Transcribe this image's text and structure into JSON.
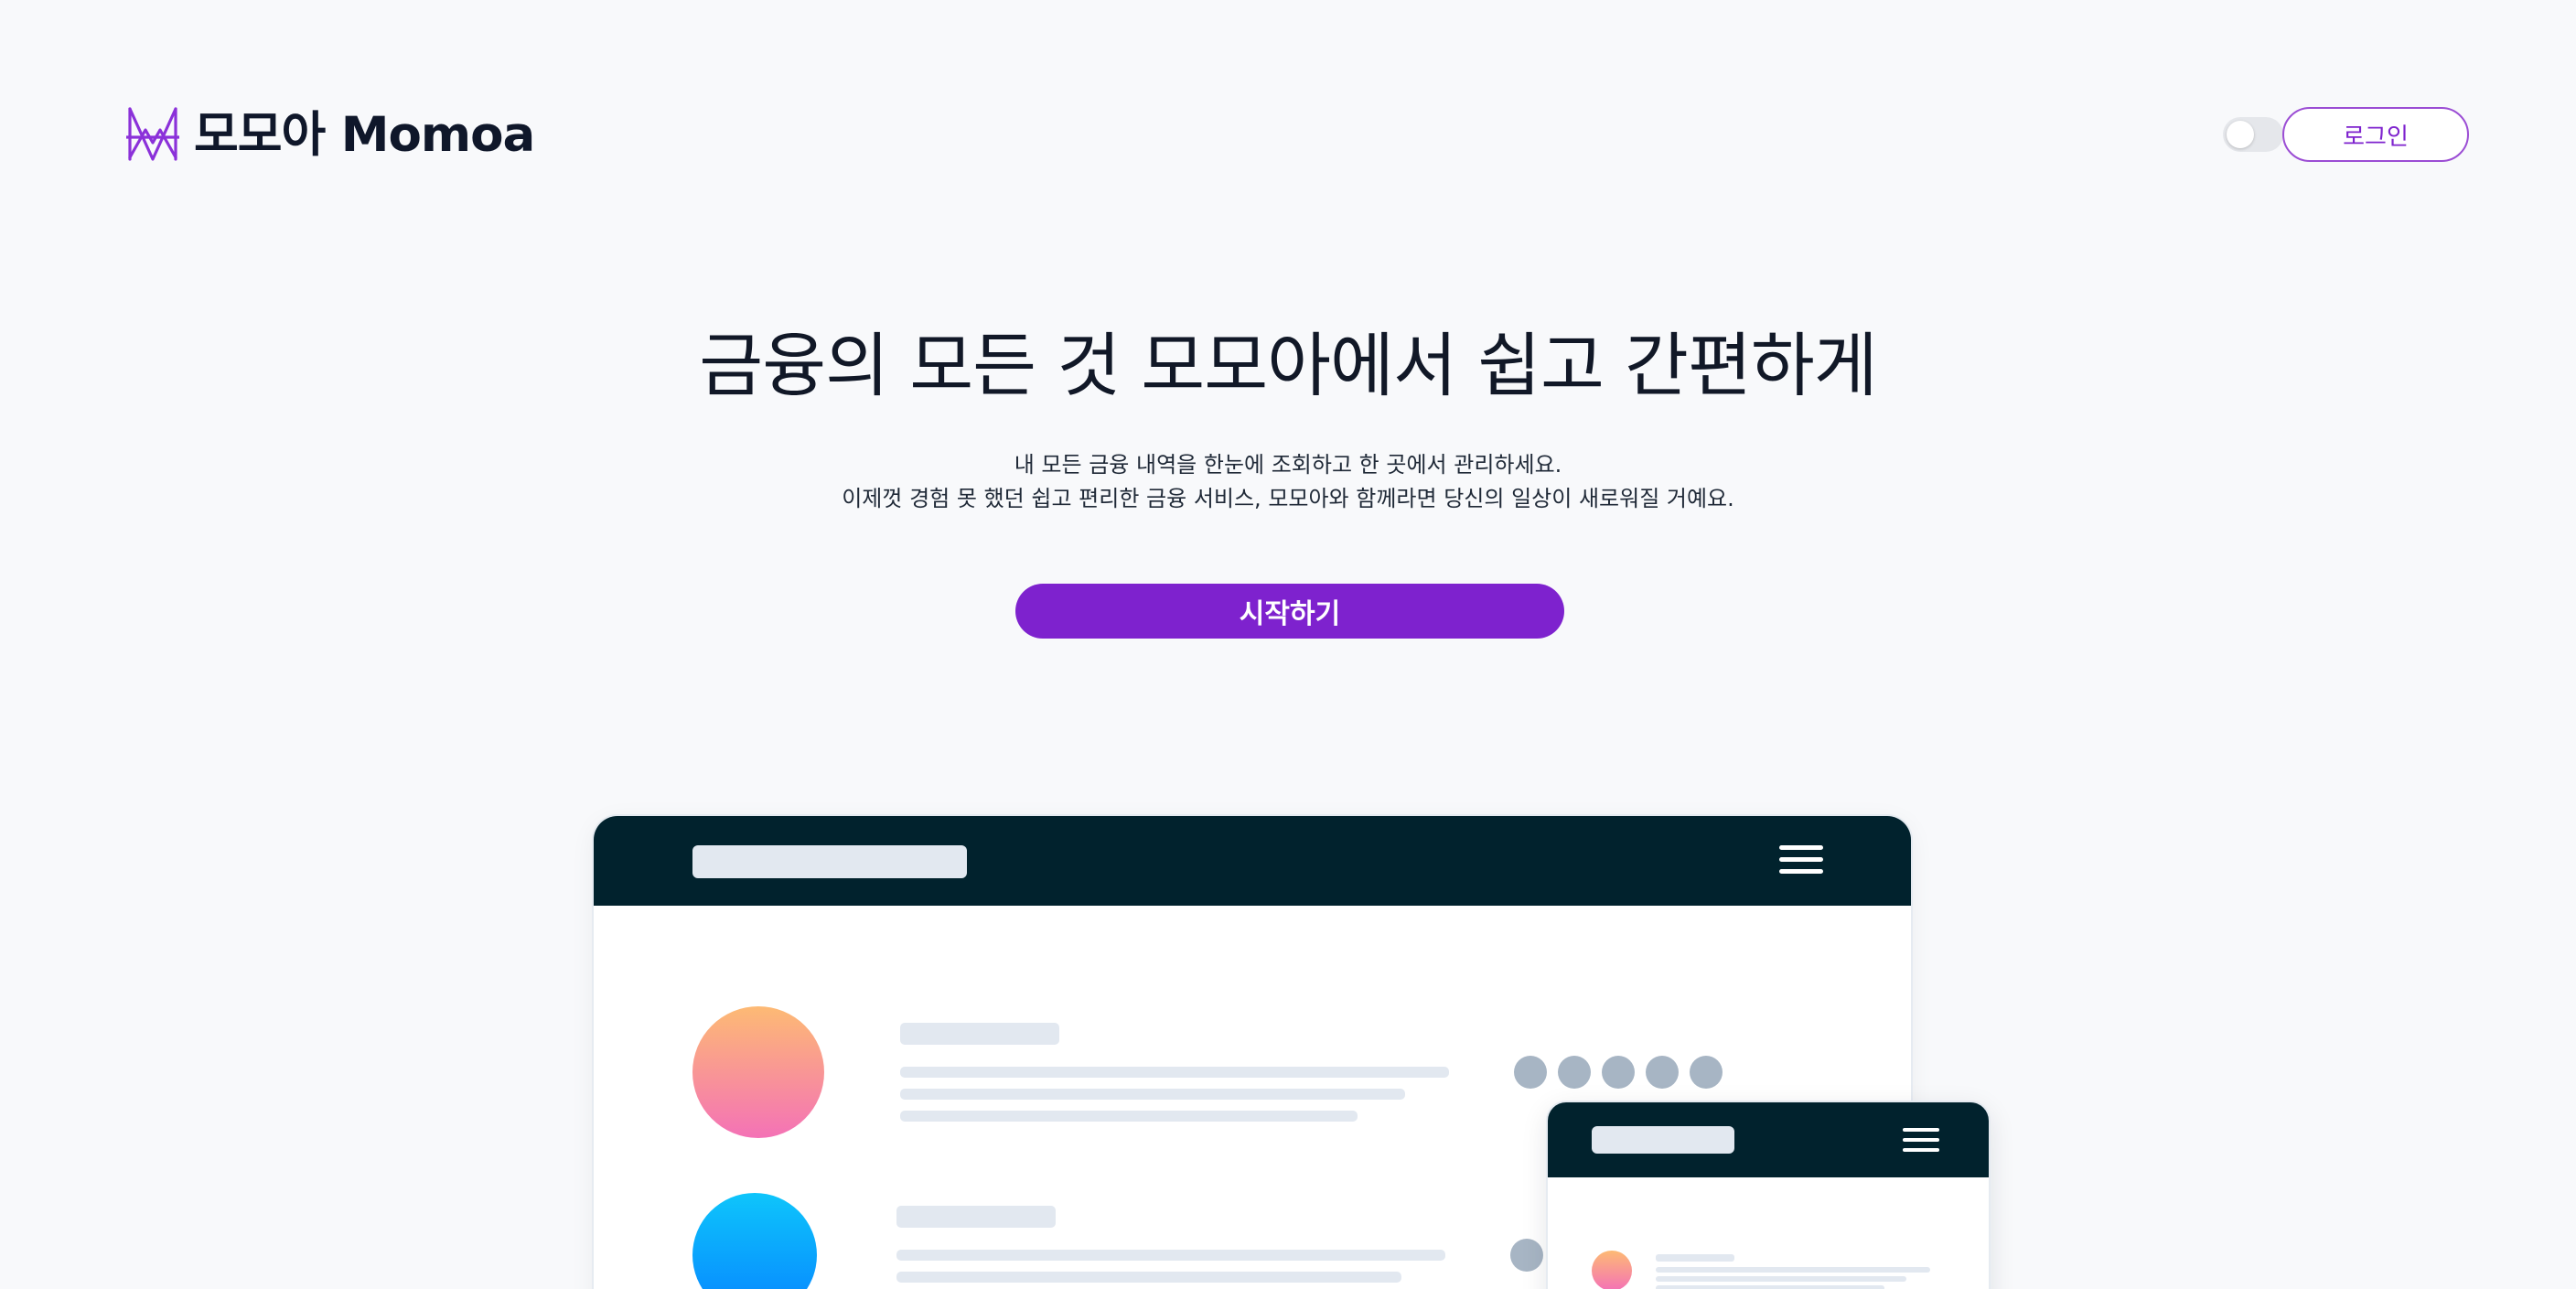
{
  "brand": {
    "name": "모모아 Momoa",
    "icon": "momoa-logo-icon",
    "accent_color": "#7e22ce"
  },
  "header": {
    "theme_toggle": {
      "state": "off",
      "icon": "theme-toggle"
    },
    "login_label": "로그인"
  },
  "hero": {
    "title": "금융의 모든 것 모모아에서 쉽고 간편하게",
    "subtitle_line1": "내 모든 금융 내역을 한눈에 조회하고 한 곳에서 관리하세요.",
    "subtitle_line2": "이제껏 경험 못 했던 쉽고 편리한 금융 서비스, 모모아와 함께라면 당신의 일상이 새로워질 거예요.",
    "cta_label": "시작하기"
  },
  "illustration": {
    "desktop_mock": {
      "bar_color": "#01222d",
      "menu_icon": "hamburger-menu-icon"
    },
    "mobile_mock": {
      "bar_color": "#01222d",
      "menu_icon": "hamburger-menu-icon"
    }
  }
}
